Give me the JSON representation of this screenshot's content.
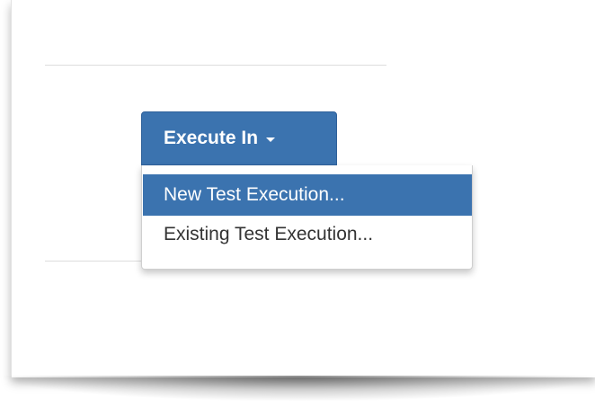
{
  "execute_button": {
    "label": "Execute In",
    "caret_icon": "caret-down-icon"
  },
  "dropdown": {
    "items": [
      {
        "label": "New Test Execution...",
        "selected": true
      },
      {
        "label": "Existing Test Execution...",
        "selected": false
      }
    ]
  },
  "colors": {
    "accent": "#3b73af",
    "text": "#333333",
    "divider": "#dddddd"
  }
}
